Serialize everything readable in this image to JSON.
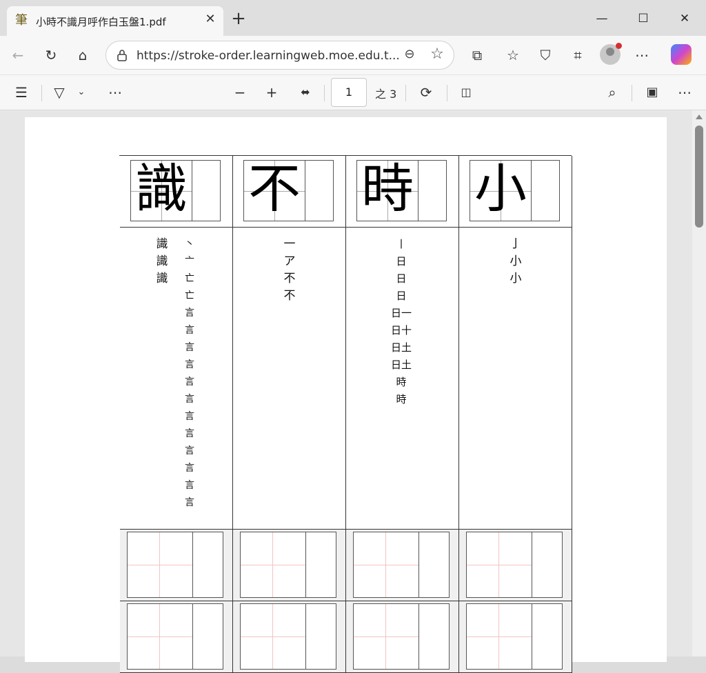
{
  "tab": {
    "title": "小時不識月呼作白玉盤1.pdf",
    "favicon": "筆"
  },
  "address": {
    "url": "https://stroke-order.learningweb.moe.edu.t..."
  },
  "pdf_toolbar": {
    "page_number": "1",
    "page_count": "之 3"
  },
  "characters": [
    {
      "char": "識",
      "strokes_left": [
        "識",
        "識",
        "識"
      ],
      "strokes_right": [
        "丶",
        "亠",
        "亡",
        "亡",
        "言",
        "言",
        "言",
        "言",
        "言",
        "言",
        "言",
        "言",
        "言",
        "言",
        "言",
        "言"
      ]
    },
    {
      "char": "不",
      "strokes": [
        "一",
        "ア",
        "不",
        "不"
      ]
    },
    {
      "char": "時",
      "strokes": [
        "丨",
        "日",
        "日",
        "日",
        "日一",
        "日十",
        "日土",
        "日土",
        "時",
        "時"
      ]
    },
    {
      "char": "小",
      "strokes": [
        "亅",
        "小",
        "小"
      ]
    }
  ]
}
